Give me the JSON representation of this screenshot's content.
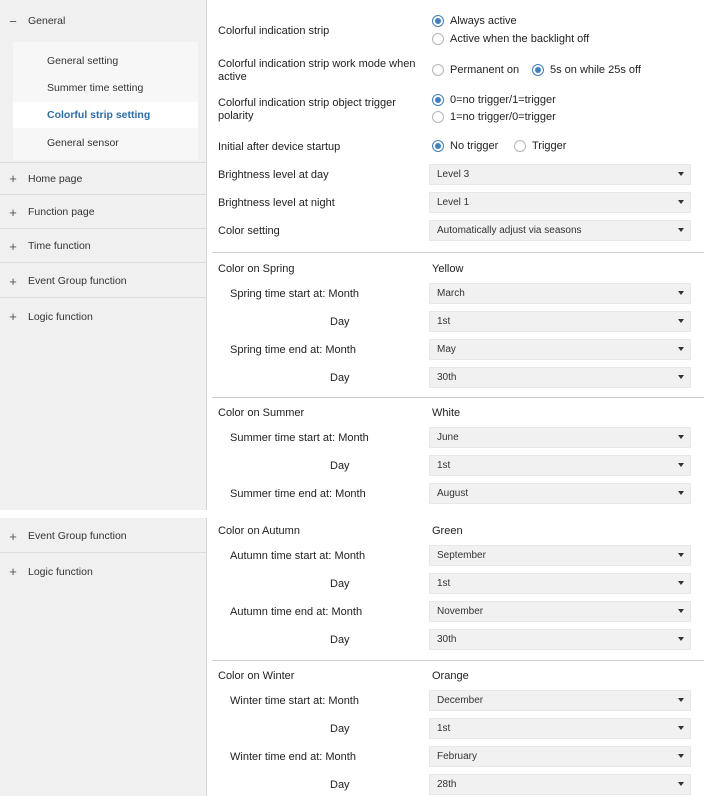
{
  "sidebar_top": {
    "general": {
      "sign": "−",
      "label": "General"
    },
    "subs": [
      {
        "label": "General setting"
      },
      {
        "label": "Summer time setting"
      },
      {
        "label": "Colorful strip setting"
      },
      {
        "label": "General sensor"
      }
    ],
    "sections": [
      {
        "sign": "+",
        "label": "Home page"
      },
      {
        "sign": "+",
        "label": "Function page"
      },
      {
        "sign": "+",
        "label": "Time function"
      },
      {
        "sign": "+",
        "label": "Event Group function"
      },
      {
        "sign": "+",
        "label": "Logic function"
      }
    ]
  },
  "sidebar_bottom": {
    "sections": [
      {
        "sign": "+",
        "label": "Event Group function"
      },
      {
        "sign": "+",
        "label": "Logic function"
      }
    ]
  },
  "params": {
    "strip": {
      "label": "Colorful indication strip",
      "opt1": "Always active",
      "opt2": "Active when the backlight off"
    },
    "mode": {
      "label": "Colorful indication strip work mode when active",
      "opt1": "Permanent on",
      "opt2": "5s on while 25s off"
    },
    "polarity": {
      "label": "Colorful  indication strip object trigger polarity",
      "opt1": "0=no trigger/1=trigger",
      "opt2": "1=no trigger/0=trigger"
    },
    "startup": {
      "label": "Initial after device startup",
      "opt1": "No trigger",
      "opt2": "Trigger"
    },
    "day_brightness": {
      "label": "Brightness level at day",
      "value": "Level 3"
    },
    "night_brightness": {
      "label": "Brightness level at night",
      "value": "Level 1"
    },
    "color_setting": {
      "label": "Color setting",
      "value": "Automatically adjust via seasons"
    }
  },
  "spring": {
    "color_label": "Color on Spring",
    "color_value": "Yellow",
    "start_label": "Spring time start at: Month",
    "start_month": "March",
    "day_label": "Day",
    "start_day": "1st",
    "end_label": "Spring time end at: Month",
    "end_month": "May",
    "end_day": "30th"
  },
  "summer": {
    "color_label": "Color on Summer",
    "color_value": "White",
    "start_label": "Summer time start at: Month",
    "start_month": "June",
    "day_label": "Day",
    "start_day": "1st",
    "end_label": "Summer time end at: Month",
    "end_month": "August"
  },
  "autumn": {
    "color_label": "Color on Autumn",
    "color_value": "Green",
    "start_label": "Autumn time start at: Month",
    "start_month": "September",
    "day_label": "Day",
    "start_day": "1st",
    "end_label": "Autumn time end at: Month",
    "end_month": "November",
    "end_day": "30th"
  },
  "winter": {
    "color_label": "Color on Winter",
    "color_value": "Orange",
    "start_label": "Winter time start at: Month",
    "start_month": "December",
    "day_label": "Day",
    "start_day": "1st",
    "end_label": "Winter time end at: Month",
    "end_month": "February",
    "end_day": "28th"
  },
  "colors": {
    "accent": "#2a6db0",
    "radio": "#3f7fc2",
    "sidebar_bg": "#f0f0f0",
    "select_bg": "#f1f1f1"
  }
}
